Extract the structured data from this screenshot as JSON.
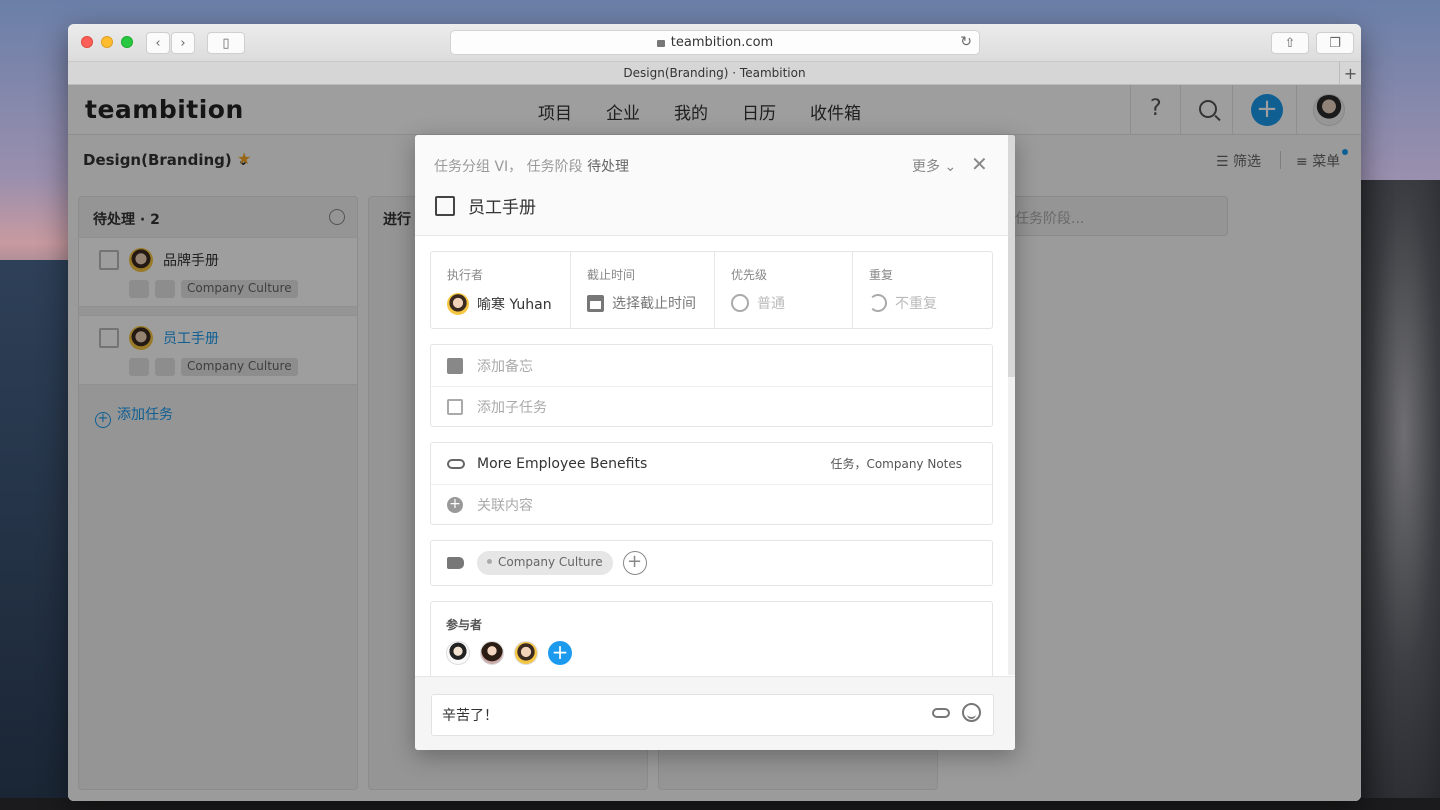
{
  "browser": {
    "url": "teambition.com",
    "tab_title": "Design(Branding) · Teambition"
  },
  "app": {
    "logo": "teambition",
    "nav": [
      "项目",
      "企业",
      "我的",
      "日历",
      "收件箱"
    ],
    "help_label": "?",
    "add_label": "+",
    "project_title": "Design(Branding)",
    "filter_label": "筛选",
    "menu_label": "菜单"
  },
  "board": {
    "column1": {
      "title": "待处理 · 2",
      "cards": [
        {
          "title": "品牌手册",
          "tag": "Company Culture"
        },
        {
          "title": "员工手册",
          "tag": "Company Culture"
        }
      ],
      "add_task": "添加任务"
    },
    "column2": {
      "title": "进行"
    },
    "new_stage_placeholder": "任务阶段..."
  },
  "modal": {
    "crumb_group": "任务分组 VI，",
    "crumb_stage_label": "任务阶段",
    "crumb_stage_value": "待处理",
    "more_label": "更多",
    "close_label": "✕",
    "task_title": "员工手册",
    "fields": {
      "executor_label": "执行者",
      "executor_value": "喻寒 Yuhan",
      "deadline_label": "截止时间",
      "deadline_value": "选择截止时间",
      "priority_label": "优先级",
      "priority_value": "普通",
      "repeat_label": "重复",
      "repeat_value": "不重复"
    },
    "note_placeholder": "添加备忘",
    "subtask_placeholder": "添加子任务",
    "linked": {
      "title": "More Employee Benefits",
      "meta": "任务，Company Notes",
      "add_label": "关联内容"
    },
    "tag": "Company Culture",
    "participants_label": "参与者",
    "comment_value": "辛苦了！"
  },
  "colors": {
    "accent": "#1b9aee",
    "star": "#f5a623"
  }
}
